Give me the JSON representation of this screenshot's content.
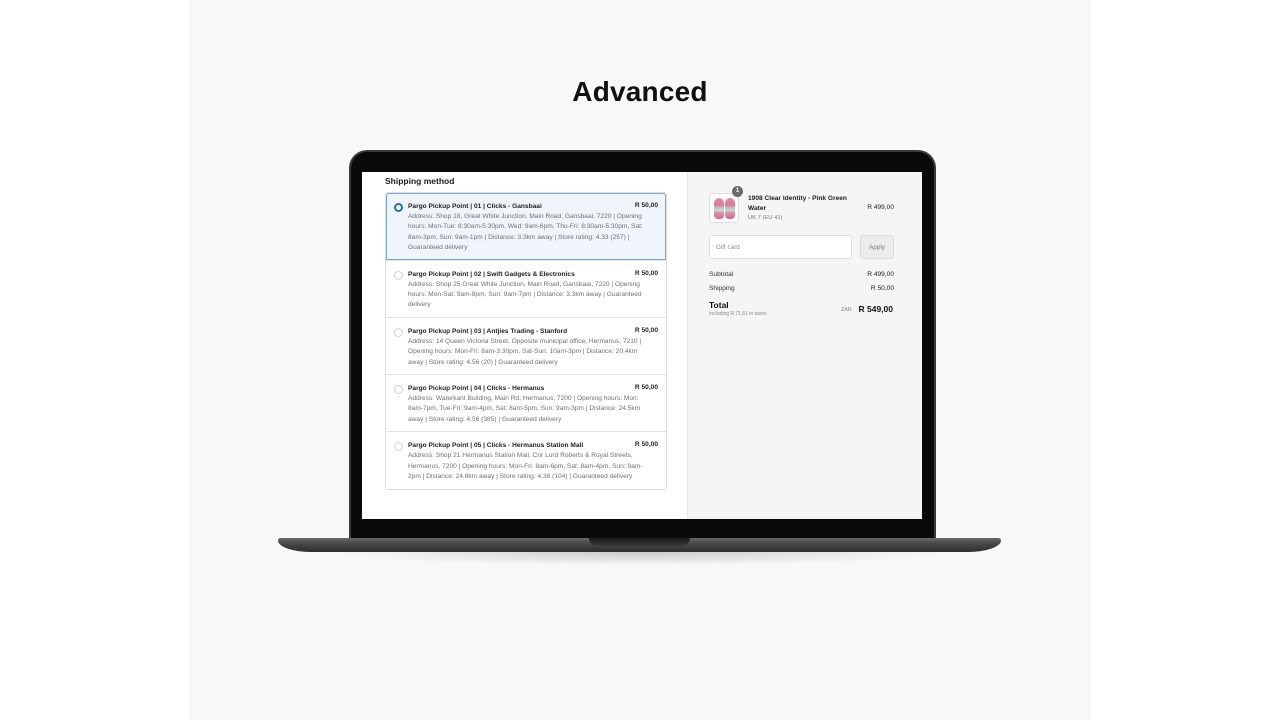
{
  "headline": "Advanced",
  "checkout": {
    "shipping": {
      "section_title": "Shipping method",
      "options": [
        {
          "title": "Pargo Pickup Point | 01 | Clicks - Gansbaai",
          "price": "R 50,00",
          "description": "Address: Shop 18, Great White Junction, Main Road, Gansbaai, 7220 | Opening hours: Mon-Tue: 8:30am-5:30pm, Wed: 9am-6pm, Thu-Fri: 8:30am-5:30pm, Sat: 8am-3pm, Sun: 9am-1pm | Distance: 3.3km away | Store rating: 4.33 (257) | Guaranteed delivery",
          "selected": true
        },
        {
          "title": "Pargo Pickup Point | 02 | Swift Gadgets & Electronics",
          "price": "R 50,00",
          "description": "Address: Shop 25 Great White Junction, Main Road, Gansbaai, 7220 | Opening hours: Mon-Sat: 9am-8pm, Sun: 9am-7pm | Distance: 3.3km away | Guaranteed delivery",
          "selected": false
        },
        {
          "title": "Pargo Pickup Point | 03 | Antjies Trading - Stanford",
          "price": "R 50,00",
          "description": "Address: 14 Queen Victoria Street, Opposite municipal office, Hermanus, 7210 | Opening hours: Mon-Fri: 8am-3:30pm, Sat-Sun: 10am-3pm | Distance: 20.4km away | Store rating: 4.56 (20) | Guaranteed delivery",
          "selected": false
        },
        {
          "title": "Pargo Pickup Point | 04 | Clicks - Hermanus",
          "price": "R 50,00",
          "description": "Address: Waterkant Building, Main Rd, Hermanus, 7200 | Opening hours: Mon: 8am-7pm, Tue-Fri: 9am-4pm, Sat: 8am-5pm, Sun: 9am-3pm | Distance: 24.5km away | Store rating: 4.56 (385) | Guaranteed delivery",
          "selected": false
        },
        {
          "title": "Pargo Pickup Point | 05 | Clicks - Hermanus Station Mall",
          "price": "R 50,00",
          "description": "Address: Shop 21 Hermanus Station Mall, Cnr Lord Roberts & Royal Streets, Hermanus, 7200 | Opening hours: Mon-Fri: 8am-6pm, Sat: 8am-4pm, Sun: 9am-2pm | Distance: 24.8km away | Store rating: 4.38 (104) | Guaranteed delivery",
          "selected": false
        }
      ]
    },
    "summary": {
      "product": {
        "name": "1908 Clear Identity - Pink Green Water",
        "variant": "UK 7 (EU 41)",
        "price": "R 499,00",
        "quantity": "1",
        "image_icon": "pink-slippers-image"
      },
      "gift_card": {
        "placeholder": "Gift card",
        "value": "",
        "apply_label": "Apply"
      },
      "subtotal_label": "Subtotal",
      "subtotal_value": "R 499,00",
      "shipping_label": "Shipping",
      "shipping_value": "R 50,00",
      "total_label": "Total",
      "tax_note": "Including R 71,61 in taxes",
      "currency": "ZAR",
      "total_value": "R 549,00"
    }
  },
  "colors": {
    "accent": "#1f6fb2",
    "selected_bg": "#f0f5fc",
    "summary_bg": "#f5f5f5",
    "stage_bg": "#f8f8f8"
  }
}
